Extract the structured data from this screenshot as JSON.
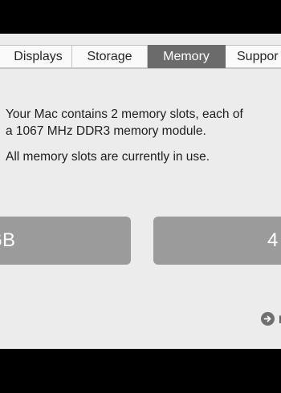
{
  "tabs": [
    {
      "label": "Displays",
      "active": false
    },
    {
      "label": "Storage",
      "active": false
    },
    {
      "label": "Memory",
      "active": true
    },
    {
      "label": "Suppor",
      "active": false
    }
  ],
  "memory": {
    "line1": "Your Mac contains 2 memory slots, each of",
    "line2": "a 1067 MHz DDR3 memory module.",
    "status": "All memory slots are currently in use.",
    "slots": [
      {
        "label": "GB"
      },
      {
        "label": "4"
      }
    ]
  },
  "footer": {
    "link_label": "I"
  },
  "colors": {
    "window_bg": "#ececec",
    "active_tab": "#6b6b6b",
    "slot_bg": "#9b9b9b"
  },
  "icons": {
    "more_info": "arrow-right-circle-icon"
  }
}
